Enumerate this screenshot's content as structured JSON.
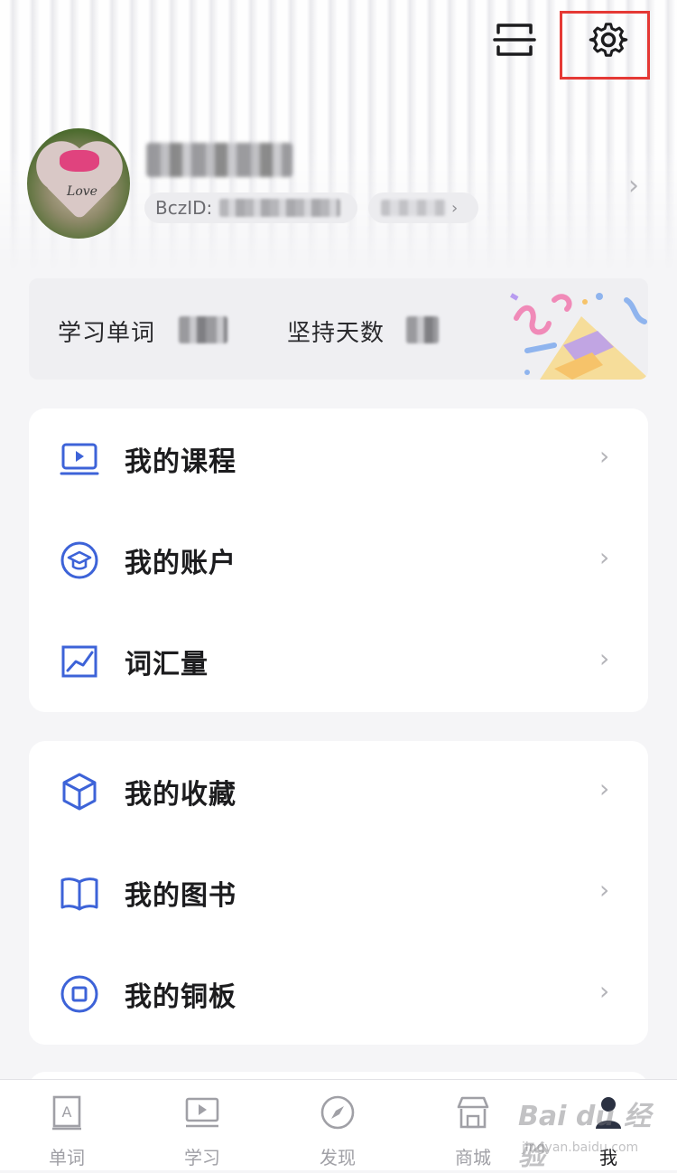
{
  "top_bar": {
    "scan_icon": "scan-icon",
    "settings_icon": "gear-icon",
    "highlight_color": "#e53935"
  },
  "profile": {
    "avatar_text": "Love",
    "id_label": "BczID:"
  },
  "stats": {
    "words_label": "学习单词",
    "days_label": "坚持天数"
  },
  "menu_group_1": [
    {
      "label": "我的课程",
      "icon": "course-screen-icon"
    },
    {
      "label": "我的账户",
      "icon": "graduation-cap-icon"
    },
    {
      "label": "词汇量",
      "icon": "chart-line-icon"
    }
  ],
  "menu_group_2": [
    {
      "label": "我的收藏",
      "icon": "cube-icon"
    },
    {
      "label": "我的图书",
      "icon": "book-icon"
    },
    {
      "label": "我的铜板",
      "icon": "coin-icon"
    }
  ],
  "tabbar": [
    {
      "label": "单词",
      "icon": "word-card-icon",
      "active": false
    },
    {
      "label": "学习",
      "icon": "study-screen-icon",
      "active": false
    },
    {
      "label": "发现",
      "icon": "compass-icon",
      "active": false
    },
    {
      "label": "商城",
      "icon": "store-icon",
      "active": false
    },
    {
      "label": "我",
      "icon": "person-icon",
      "active": true
    }
  ],
  "watermark": {
    "main": "Bai du 经验",
    "sub": "jingyan.baidu.com"
  },
  "colors": {
    "accent_blue": "#3d63d8",
    "tab_inactive": "#a0a0a6"
  }
}
